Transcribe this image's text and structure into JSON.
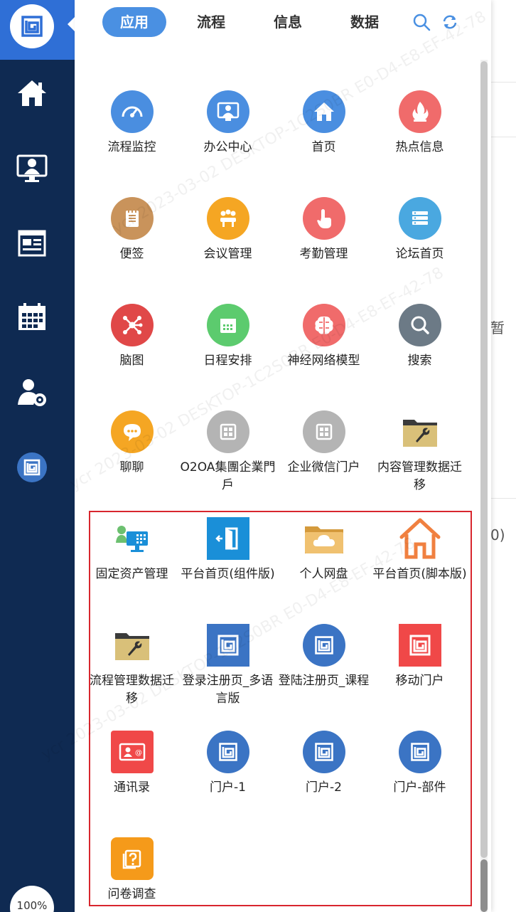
{
  "tabs": [
    {
      "label": "应用",
      "active": true
    },
    {
      "label": "流程",
      "active": false
    },
    {
      "label": "信息",
      "active": false
    },
    {
      "label": "数据",
      "active": false
    }
  ],
  "zoom": "100%",
  "background": {
    "right_text_1": "暂",
    "right_text_2": "0)"
  },
  "watermark": "ycr 2023-03-02 DESKTOP-1C2S0BR E0-D4-E8-EF-42-78",
  "apps": [
    {
      "label": "流程监控",
      "icon": "gauge-icon",
      "color": "#4a8ee0"
    },
    {
      "label": "办公中心",
      "icon": "office-user-icon",
      "color": "#4a8ee0"
    },
    {
      "label": "首页",
      "icon": "home-icon",
      "color": "#4a8ee0"
    },
    {
      "label": "热点信息",
      "icon": "flame-icon",
      "color": "#f06b6b"
    },
    {
      "label": "便签",
      "icon": "notepad-icon",
      "color": "#c9935b"
    },
    {
      "label": "会议管理",
      "icon": "meeting-icon",
      "color": "#f5a623"
    },
    {
      "label": "考勤管理",
      "icon": "touch-icon",
      "color": "#f06b6b"
    },
    {
      "label": "论坛首页",
      "icon": "forum-icon",
      "color": "#4aa8e0"
    },
    {
      "label": "脑图",
      "icon": "mindmap-icon",
      "color": "#e04848"
    },
    {
      "label": "日程安排",
      "icon": "calendar-icon",
      "color": "#5ccb6e"
    },
    {
      "label": "神经网络模型",
      "icon": "brain-icon",
      "color": "#f06b6b"
    },
    {
      "label": "搜索",
      "icon": "search-icon",
      "color": "#6c7a86"
    },
    {
      "label": "聊聊",
      "icon": "chat-icon",
      "color": "#f5a623"
    },
    {
      "label": "O2OA集團企業門戶",
      "icon": "portal-grid-icon",
      "color": "#b4b4b4"
    },
    {
      "label": "企业微信门户",
      "icon": "portal-grid-icon",
      "color": "#b4b4b4"
    },
    {
      "label": "内容管理数据迁移",
      "icon": "folder-wrench-icon",
      "color": "#d4b865"
    },
    {
      "label": "固定资产管理",
      "icon": "asset-icon",
      "color": "#1a8fd8"
    },
    {
      "label": "平台首页(组件版)",
      "icon": "door-exit-icon",
      "color": "#1a8fd8"
    },
    {
      "label": "个人网盘",
      "icon": "cloud-folder-icon",
      "color": "#e6b45e"
    },
    {
      "label": "平台首页(脚本版)",
      "icon": "house-outline-icon",
      "color": "#f08040"
    },
    {
      "label": "流程管理数据迁移",
      "icon": "folder-wrench-icon",
      "color": "#d4b865"
    },
    {
      "label": "登录注册页_多语言版",
      "icon": "o2-logo-icon",
      "color": "#3b74c4"
    },
    {
      "label": "登陆注册页_课程",
      "icon": "o2-logo-icon",
      "color": "#3b74c4"
    },
    {
      "label": "移动门户",
      "icon": "o2-logo-icon",
      "color": "#f04848"
    },
    {
      "label": "通讯录",
      "icon": "contact-card-icon",
      "color": "#f04848"
    },
    {
      "label": "门户-1",
      "icon": "o2-logo-icon",
      "color": "#3b74c4"
    },
    {
      "label": "门户-2",
      "icon": "o2-logo-icon",
      "color": "#3b74c4"
    },
    {
      "label": "门户-部件",
      "icon": "o2-logo-icon",
      "color": "#3b74c4"
    },
    {
      "label": "问卷调查",
      "icon": "questionnaire-icon",
      "color": "#f59a1a"
    }
  ]
}
